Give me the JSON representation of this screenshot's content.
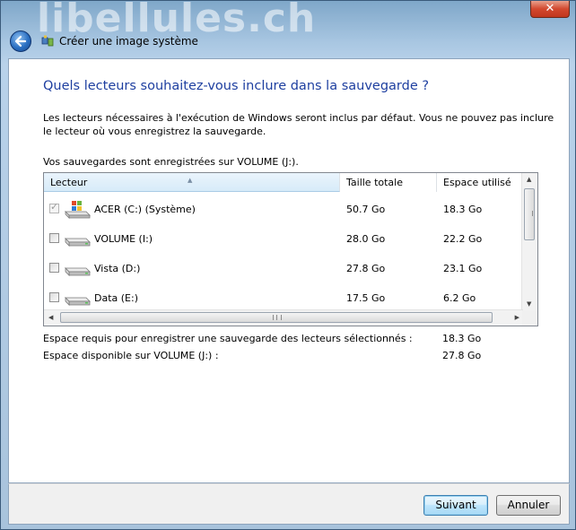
{
  "window": {
    "watermark": "libellules.ch",
    "title": "Créer une image système",
    "close_label": "✕"
  },
  "page": {
    "heading": "Quels lecteurs souhaitez-vous inclure dans la sauvegarde ?",
    "description": "Les lecteurs nécessaires à l'exécution de Windows seront inclus par défaut. Vous ne pouvez pas inclure le lecteur où vous enregistrez la sauvegarde.",
    "save_location": "Vos sauvegardes sont enregistrées sur VOLUME (J:)."
  },
  "table": {
    "columns": [
      "Lecteur",
      "Taille totale",
      "Espace utilisé"
    ],
    "rows": [
      {
        "name": "ACER (C:) (Système)",
        "total": "50.7 Go",
        "used": "18.3 Go",
        "checked": true,
        "disabled": true,
        "icon": "windows-drive-icon"
      },
      {
        "name": "VOLUME (I:)",
        "total": "28.0 Go",
        "used": "22.2 Go",
        "checked": false,
        "disabled": false,
        "icon": "hard-drive-icon"
      },
      {
        "name": "Vista (D:)",
        "total": "27.8 Go",
        "used": "23.1 Go",
        "checked": false,
        "disabled": false,
        "icon": "hard-drive-icon"
      },
      {
        "name": "Data (E:)",
        "total": "17.5 Go",
        "used": "6.2 Go",
        "checked": false,
        "disabled": false,
        "icon": "hard-drive-icon"
      }
    ]
  },
  "summary": {
    "required_label": "Espace requis pour enregistrer une sauvegarde des lecteurs sélectionnés :",
    "required_value": "18.3 Go",
    "available_label": "Espace disponible sur VOLUME (J:) :",
    "available_value": "27.8 Go"
  },
  "buttons": {
    "next_label": "Suivant",
    "cancel_label": "Annuler"
  }
}
